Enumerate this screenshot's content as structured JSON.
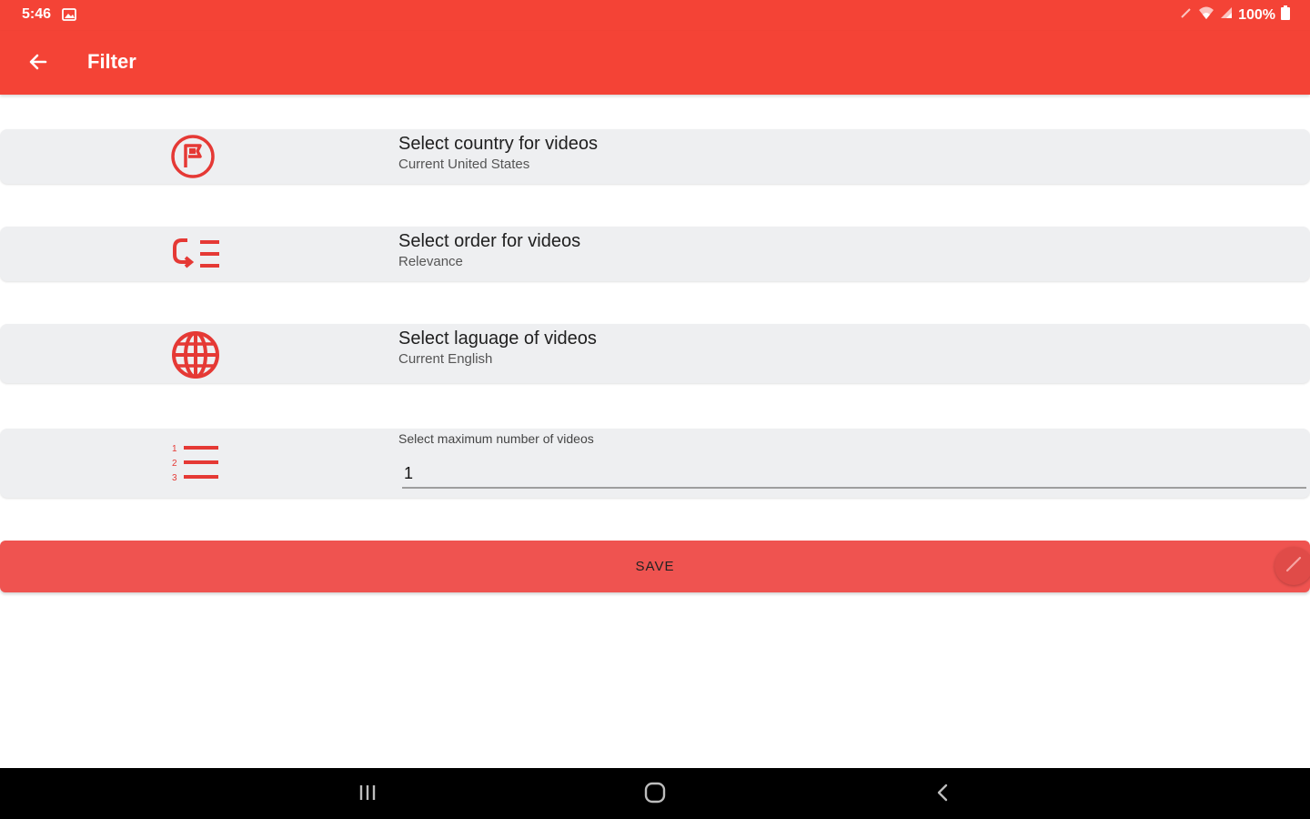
{
  "status_bar": {
    "time": "5:46",
    "battery": "100%",
    "icons": [
      "image-icon",
      "pencil-icon",
      "wifi-icon",
      "signal-icon",
      "battery-icon"
    ]
  },
  "app_bar": {
    "title": "Filter",
    "back_icon": "arrow-left-icon"
  },
  "filters": [
    {
      "title": "Select country for videos",
      "subtitle": "Current United States",
      "icon": "flag-circle-icon"
    },
    {
      "title": "Select order for videos",
      "subtitle": "Relevance",
      "icon": "sort-list-icon"
    },
    {
      "title": "Select laguage  of videos",
      "subtitle": "Current English",
      "icon": "globe-icon"
    }
  ],
  "max_videos": {
    "label": "Select maximum number of videos",
    "value": "1",
    "icon": "numbered-list-icon"
  },
  "save_button": {
    "label": "SAVE"
  },
  "nav_bar": {
    "icons": [
      "recent-apps-icon",
      "home-icon",
      "back-icon"
    ]
  },
  "colors": {
    "primary": "#f44336",
    "accent": "#ef5350",
    "card": "#eeeff1",
    "icon": "#e53935"
  }
}
